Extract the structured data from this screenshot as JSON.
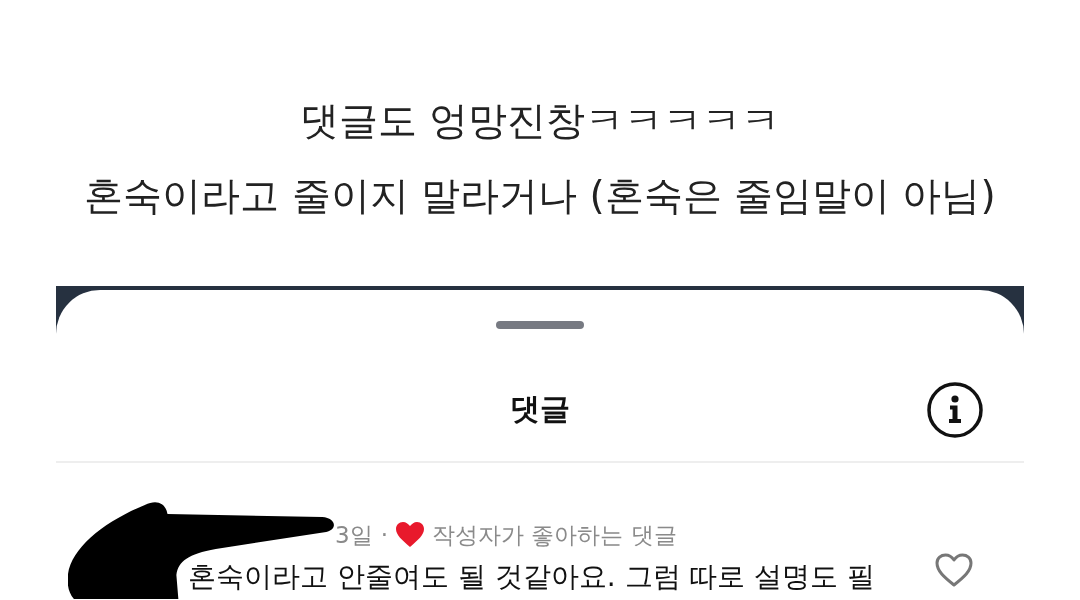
{
  "caption": {
    "lines": [
      "댓글도 엉망진창ㅋㅋㅋㅋㅋ",
      "혼숙이라고 줄이지 말라거나 (혼숙은 줄임말이 아님)"
    ]
  },
  "sheet": {
    "title": "댓글",
    "comments": [
      {
        "redacted": true,
        "time": "3일",
        "separator": "·",
        "author_liked": true,
        "badge": "작성자가 좋아하는 댓글",
        "text": "혼숙이라고 안줄여도 될 것같아요. 그럼 따로 설명도 필",
        "liked": false
      }
    ]
  }
}
